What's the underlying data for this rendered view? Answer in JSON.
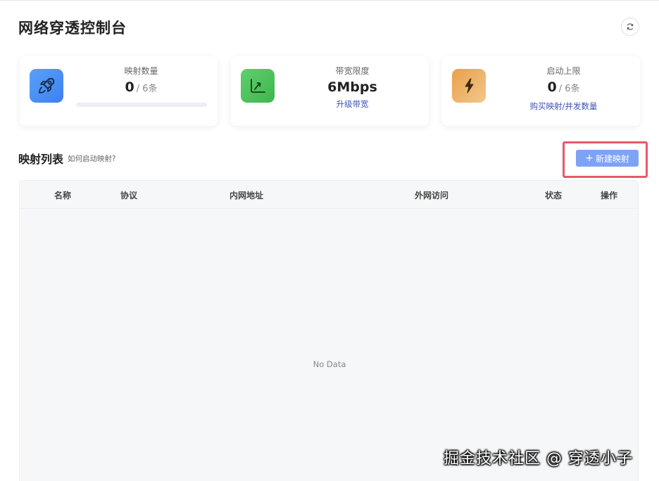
{
  "header": {
    "title": "网络穿透控制台",
    "refresh_icon": "refresh-icon"
  },
  "cards": [
    {
      "label": "映射数量",
      "value": "0",
      "suffix": "/ 6条",
      "icon": "rocket-icon",
      "color": "#4a90f5",
      "progress": 0
    },
    {
      "label": "带宽限度",
      "value": "6Mbps",
      "link": "升级带宽",
      "icon": "chart-growth-icon",
      "color": "#4cc35a"
    },
    {
      "label": "启动上限",
      "value": "0",
      "suffix": "/ 6条",
      "link": "购买映射/并发数量",
      "icon": "lightning-icon",
      "color": "#eaa14a"
    }
  ],
  "section": {
    "title": "映射列表",
    "help": "如何启动映射?",
    "new_button": "新建映射"
  },
  "table": {
    "columns": [
      "名称",
      "协议",
      "内网地址",
      "外网访问",
      "状态",
      "操作"
    ],
    "empty_text": "No Data"
  },
  "watermark": "掘金技术社区 @ 穿透小子",
  "colors": {
    "accent": "#7ea3f5",
    "highlight": "#e8596b",
    "link": "#3f51b5"
  }
}
